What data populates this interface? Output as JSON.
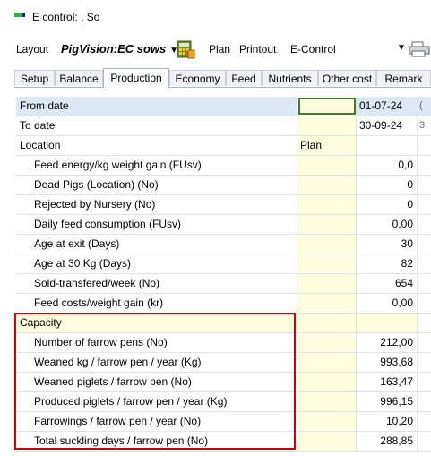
{
  "window": {
    "title": "E control: , So"
  },
  "toolbar": {
    "layout_label": "Layout",
    "layout_value": "PigVision:EC sows",
    "plan_label": "Plan",
    "printout_label": "Printout",
    "econtrol_label": "E-Control",
    "icons": [
      "calculator-icon",
      "chevron-down-icon",
      "printer-icon"
    ]
  },
  "tabs": [
    {
      "label": "Setup"
    },
    {
      "label": "Balance"
    },
    {
      "label": "Production",
      "active": true
    },
    {
      "label": "Economy"
    },
    {
      "label": "Feed"
    },
    {
      "label": "Nutrients"
    },
    {
      "label": "Other cost"
    },
    {
      "label": "Remark"
    }
  ],
  "grid": {
    "rows": [
      {
        "label": "From date",
        "plan": "",
        "value": "01-07-24",
        "extra": "("
      },
      {
        "label": "To date",
        "plan": "",
        "value": "30-09-24",
        "extra": "3"
      },
      {
        "label": "Location",
        "plan": "Plan",
        "value": "",
        "extra": ""
      },
      {
        "label": "Feed energy/kg weight gain (FUsv)",
        "plan": "",
        "value": "0,0",
        "extra": ""
      },
      {
        "label": "Dead Pigs (Location) (No)",
        "plan": "",
        "value": "0",
        "extra": ""
      },
      {
        "label": "Rejected by Nursery (No)",
        "plan": "",
        "value": "0",
        "extra": ""
      },
      {
        "label": "Daily feed consumption (FUsv)",
        "plan": "",
        "value": "0,00",
        "extra": ""
      },
      {
        "label": "Age at exit (Days)",
        "plan": "",
        "value": "30",
        "extra": ""
      },
      {
        "label": "Age at 30 Kg (Days)",
        "plan": "",
        "value": "82",
        "extra": ""
      },
      {
        "label": "Sold-transfered/week (No)",
        "plan": "",
        "value": "654",
        "extra": ""
      },
      {
        "label": "Feed costs/weight gain (kr)",
        "plan": "",
        "value": "0,00",
        "extra": ""
      },
      {
        "label": "Capacity",
        "plan": "",
        "value": "",
        "extra": ""
      },
      {
        "label": "Number of farrow pens (No)",
        "plan": "",
        "value": "212,00",
        "extra": ""
      },
      {
        "label": "Weaned kg / farrow pen / year (Kg)",
        "plan": "",
        "value": "993,68",
        "extra": ""
      },
      {
        "label": "Weaned piglets / farrow pen (No)",
        "plan": "",
        "value": "163,47",
        "extra": ""
      },
      {
        "label": "Produced piglets / farrow pen / year (Kg)",
        "plan": "",
        "value": "996,15",
        "extra": ""
      },
      {
        "label": "Farrowings / farrow pen / year (No)",
        "plan": "",
        "value": "10,20",
        "extra": ""
      },
      {
        "label": "Total suckling days / farrow pen (No)",
        "plan": "",
        "value": "288,85",
        "extra": ""
      }
    ]
  },
  "colors": {
    "highlight_row": "#dde8f5",
    "plan_column": "#fffde0",
    "focus_border": "#3e7b2a",
    "callout_box": "#d20000"
  }
}
